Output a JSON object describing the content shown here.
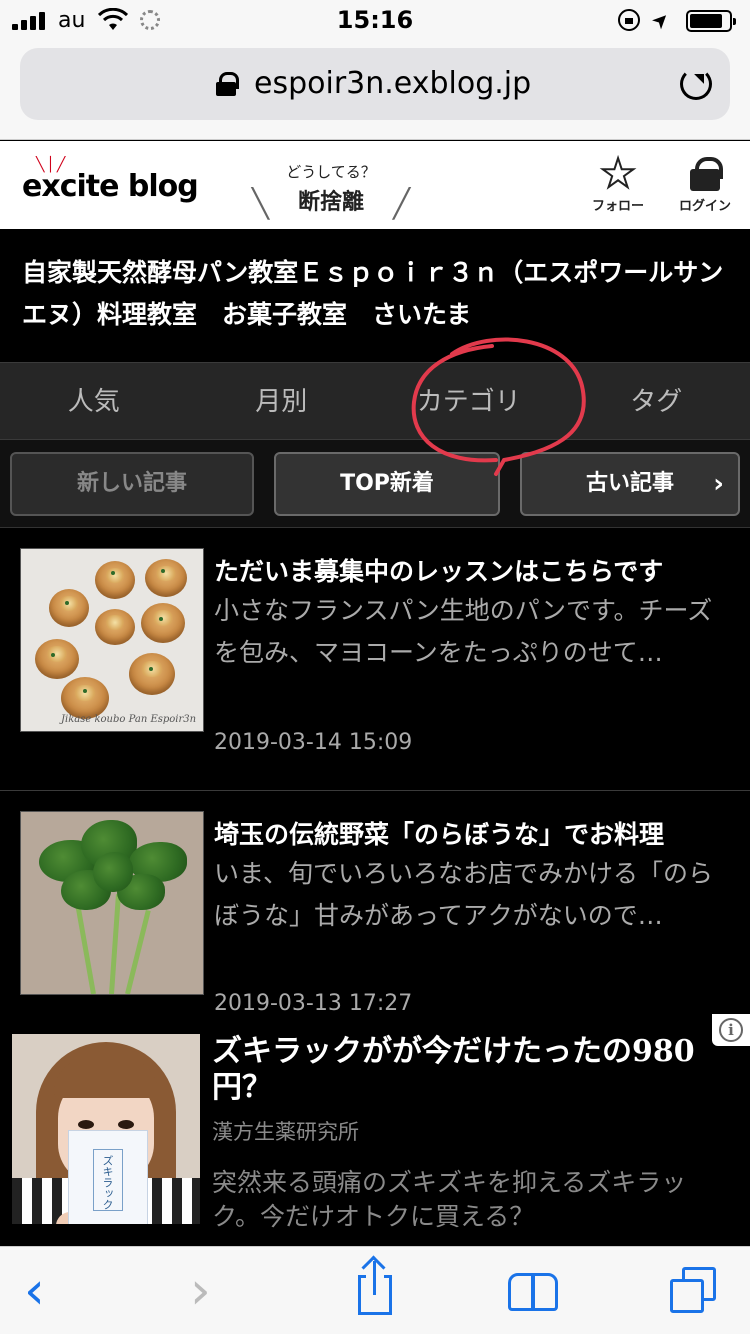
{
  "status_bar": {
    "carrier": "au",
    "time": "15:16"
  },
  "url_bar": {
    "url": "espoir3n.exblog.jp"
  },
  "header": {
    "logo_text": "excite blog",
    "prompt_question": "どうしてる？",
    "prompt_word": "断捨離",
    "follow_label": "フォロー",
    "login_label": "ログイン"
  },
  "blog": {
    "title": "自家製天然酵母パン教室Ｅｓｐｏｉｒ３ｎ（エスポワールサンエヌ）料理教室　お菓子教室　さいたま"
  },
  "tabs": [
    "人気",
    "月別",
    "カテゴリ",
    "タグ"
  ],
  "nav": {
    "newer": "新しい記事",
    "top": "TOP新着",
    "older": "古い記事"
  },
  "articles": [
    {
      "title": "ただいま募集中のレッスンはこちらです",
      "excerpt": "小さなフランスパン生地のパンです。チーズを包み、マヨコーンをたっぷりのせて…",
      "date": "2019-03-14 15:09",
      "thumb_caption": "Jikase koubo Pan Espoir3n"
    },
    {
      "title": "埼玉の伝統野菜「のらぼうな」でお料理",
      "excerpt": "いま、旬でいろいろなお店でみかける「のらぼうな」甘みがあってアクがないので…",
      "date": "2019-03-13 17:27"
    }
  ],
  "ad": {
    "title": "ズキラックがが今だけたったの980円？",
    "sponsor": "漢方生薬研究所",
    "body": "突然来る頭痛のズキズキを抑えるズキラック。今だけオトクに買える？",
    "package_text": "ズキラック",
    "info_icon": "i"
  },
  "toolbar": {
    "back": "‹",
    "forward": "›"
  },
  "colors": {
    "accent": "#1a73e8",
    "brand_red": "#d0021b",
    "annotation": "#e23a4c"
  }
}
